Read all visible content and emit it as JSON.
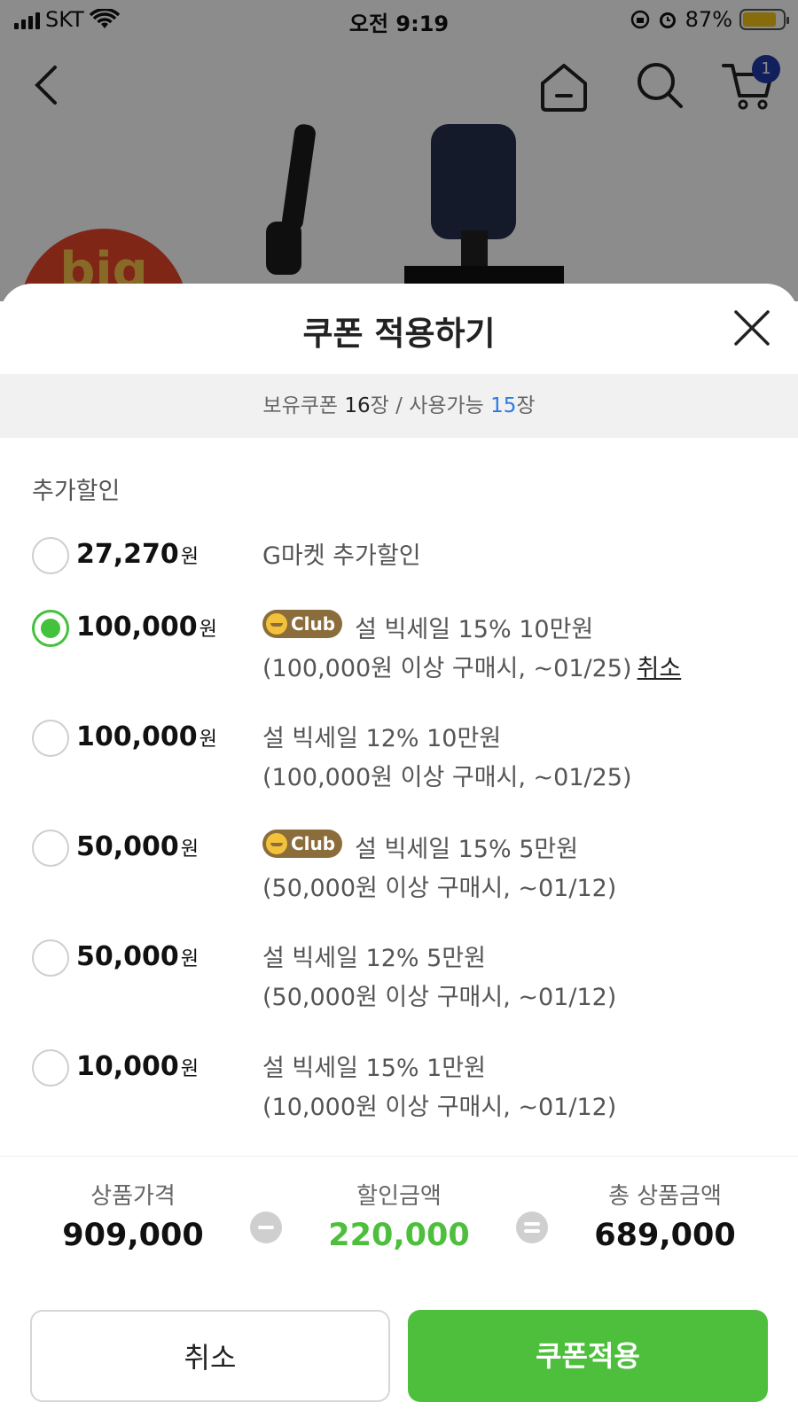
{
  "status_bar": {
    "carrier": "SKT",
    "time": "오전 9:19",
    "battery": "87%"
  },
  "nav": {
    "cart_badge": "1"
  },
  "background": {
    "logo_text": "big"
  },
  "sheet": {
    "title": "쿠폰 적용하기",
    "count": {
      "owned_label": "보유쿠폰 ",
      "owned_value": "16",
      "owned_unit": "장",
      "separator": " / ",
      "usable_label": "사용가능 ",
      "usable_value": "15",
      "usable_unit": "장"
    },
    "section_label": "추가할인",
    "coupons": [
      {
        "amount": "27,270",
        "unit": "원",
        "club": false,
        "title": "G마켓 추가할인",
        "detail": "",
        "checked": false
      },
      {
        "amount": "100,000",
        "unit": "원",
        "club": true,
        "title": "설 빅세일 15% 10만원",
        "detail": "(100,000원 이상 구매시, ~01/25)",
        "checked": true,
        "cancel": "취소"
      },
      {
        "amount": "100,000",
        "unit": "원",
        "club": false,
        "title": "설 빅세일 12% 10만원",
        "detail": "(100,000원 이상 구매시, ~01/25)",
        "checked": false
      },
      {
        "amount": "50,000",
        "unit": "원",
        "club": true,
        "title": "설 빅세일 15% 5만원",
        "detail": "(50,000원 이상 구매시, ~01/12)",
        "checked": false
      },
      {
        "amount": "50,000",
        "unit": "원",
        "club": false,
        "title": "설 빅세일 12% 5만원",
        "detail": "(50,000원 이상 구매시, ~01/12)",
        "checked": false
      },
      {
        "amount": "10,000",
        "unit": "원",
        "club": false,
        "title": "설 빅세일 15% 1만원",
        "detail": "(10,000원 이상 구매시, ~01/12)",
        "checked": false
      }
    ],
    "club_badge_label": "Club",
    "summary": {
      "price_label": "상품가격",
      "price_value": "909,000",
      "discount_label": "할인금액",
      "discount_value": "220,000",
      "total_label": "총 상품금액",
      "total_value": "689,000"
    },
    "buttons": {
      "cancel": "취소",
      "apply": "쿠폰적용"
    },
    "colors": {
      "accent_green": "#4dbf3c",
      "radio_green": "#43c23b",
      "count_blue": "#2b7be4",
      "club_brown": "#8b6d3b"
    }
  }
}
